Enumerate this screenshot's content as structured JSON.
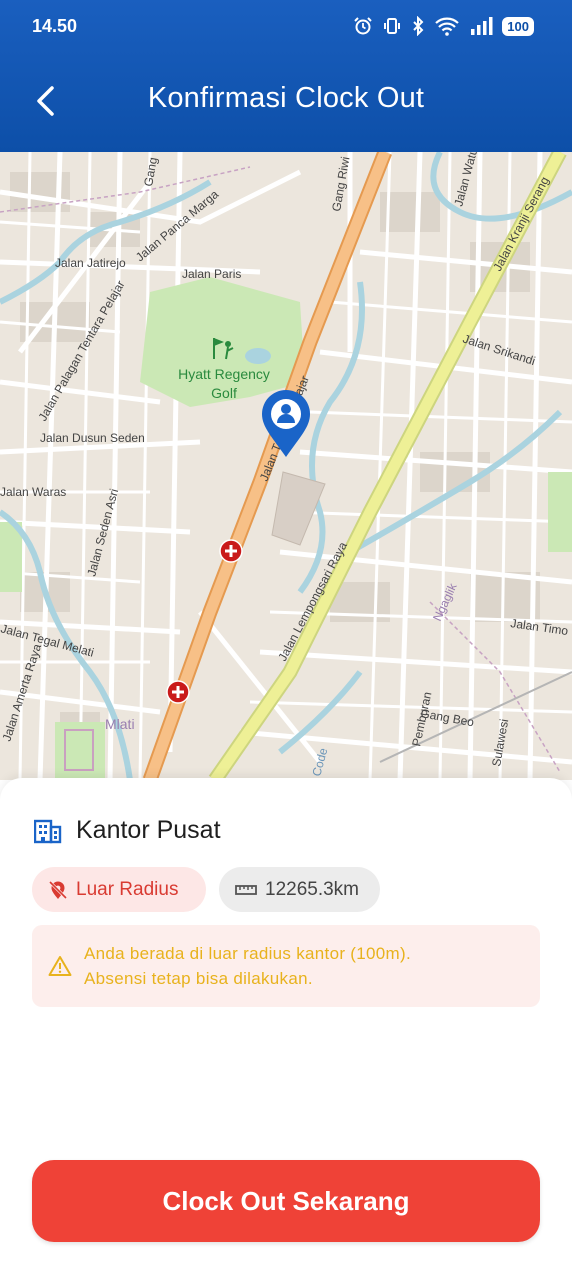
{
  "status_bar": {
    "time": "14.50",
    "battery": "100"
  },
  "header": {
    "title": "Konfirmasi Clock Out"
  },
  "map": {
    "poi": [
      "Hyatt Regency",
      "Golf"
    ],
    "labels": [
      "Jalan Tentara Pelajar",
      "Jalan Lempongsari Raya",
      "Jalan Kranji Serang",
      "Jalan Jatirejo",
      "Jalan Panca Marga",
      "Jalan Paris",
      "Jalan Palagan Tentara Pelajar",
      "Jalan Dusun Seden",
      "Jalan Seden Asri",
      "Jalan Waras",
      "Jalan Tegal Melati",
      "Jalan Amerta Raya",
      "Mlati",
      "Jalan Srikandi",
      "Jalan Watu",
      "Gang Riwi",
      "Gang",
      "Jalan Timo",
      "Gang Beo",
      "Ngaglik",
      "Pemburan",
      "Sulawesi",
      "Code"
    ]
  },
  "location": {
    "office_name": "Kantor Pusat",
    "radius_status": "Luar Radius",
    "distance": "12265.3km"
  },
  "alert": {
    "line1": "Anda berada di luar radius kantor (100m).",
    "line2": "Absensi tetap bisa dilakukan."
  },
  "action": {
    "label": "Clock Out Sekarang"
  },
  "colors": {
    "header": "#0d4fa8",
    "primary_button": "#ef4237",
    "warning_text": "#e8b21d",
    "radius_chip": "#d93b32"
  }
}
